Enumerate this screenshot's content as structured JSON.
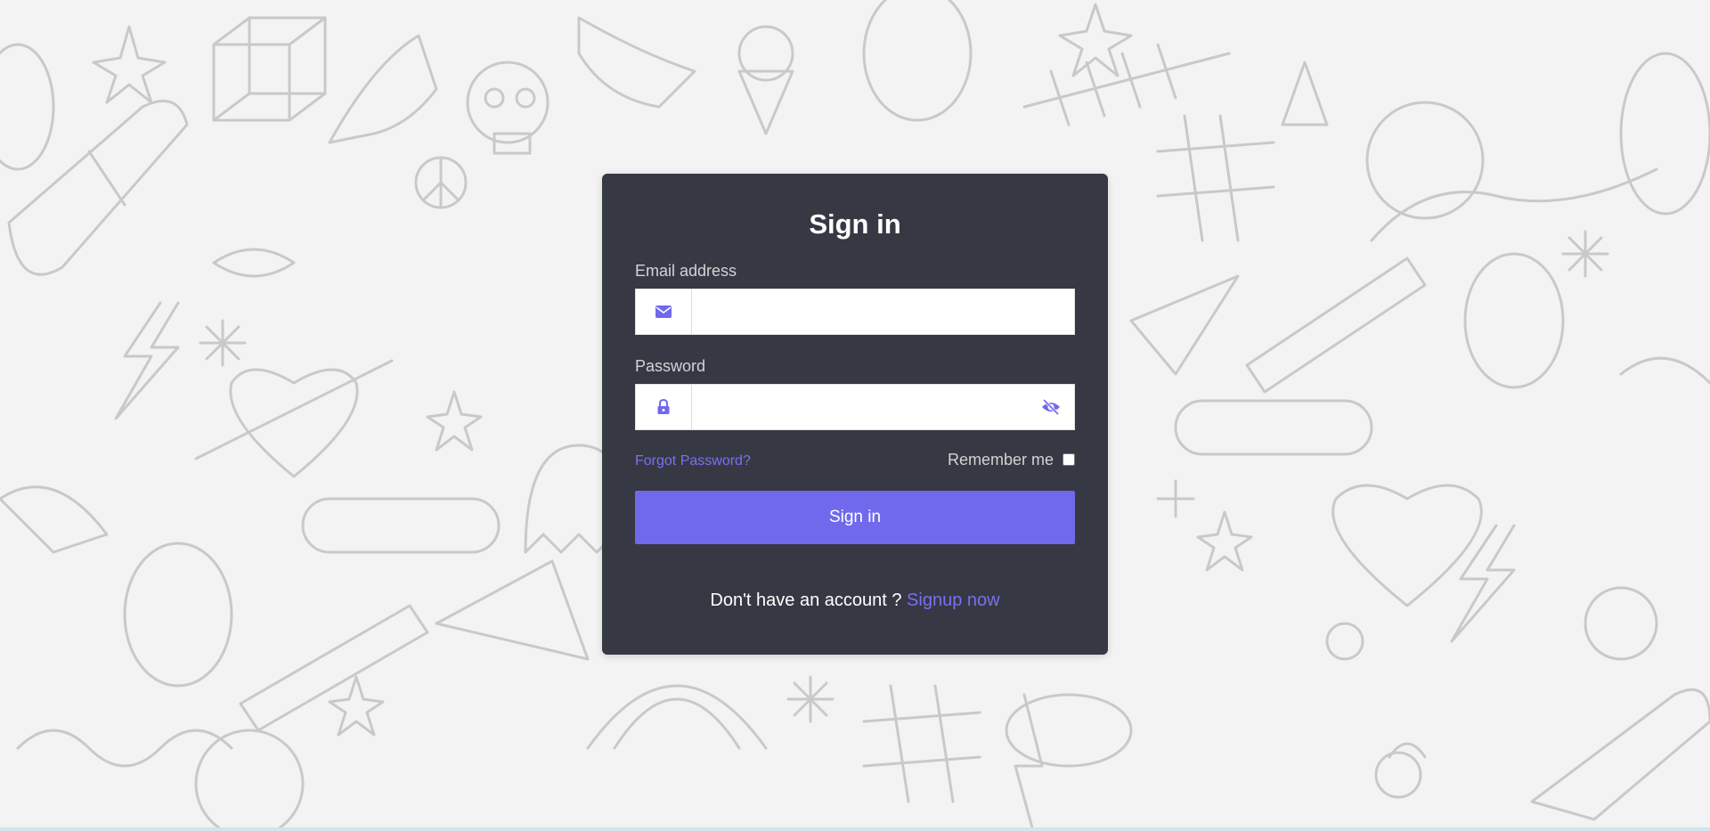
{
  "signin_form": {
    "title": "Sign in",
    "email": {
      "label": "Email address",
      "icon": "envelope-icon",
      "value": "",
      "placeholder": ""
    },
    "password": {
      "label": "Password",
      "icon": "lock-icon",
      "toggle_icon": "eye-slash-icon",
      "value": "",
      "placeholder": ""
    },
    "forgot_password": "Forgot Password?",
    "remember_me": {
      "label": "Remember me",
      "checked": false
    },
    "submit_label": "Sign in",
    "signup_prompt": "Don't have an account ?",
    "signup_link": "Signup now"
  },
  "colors": {
    "page_background": "#f3f3f3",
    "doodle_stroke": "#c9c9c9",
    "card_background": "#363943",
    "accent": "#7069ec",
    "link": "#7a6ff2",
    "label_text": "#d3d3d6",
    "bottom_strip": "#cfe6ea"
  }
}
